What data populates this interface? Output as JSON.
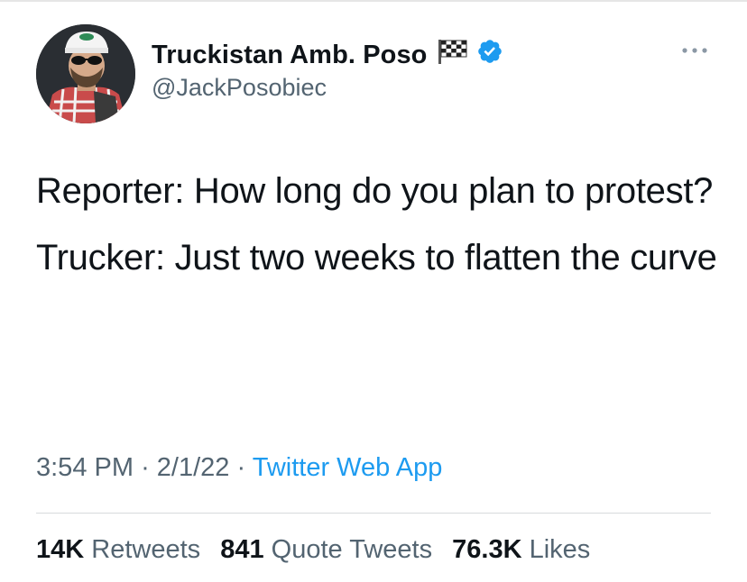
{
  "author": {
    "display_name": "Truckistan Amb. Poso",
    "handle": "@JackPosobiec"
  },
  "icons": {
    "flag": "checkered-flag-icon",
    "verified": "verified-badge-icon",
    "more": "more-options-icon"
  },
  "tweet": {
    "paragraphs": [
      "Reporter: How long do you plan to protest?",
      "Trucker: Just two weeks to flatten the curve"
    ]
  },
  "meta": {
    "time": "3:54 PM",
    "date": "2/1/22",
    "sep": "·",
    "source": "Twitter Web App"
  },
  "stats": {
    "retweets_count": "14K",
    "retweets_label": "Retweets",
    "quotes_count": "841",
    "quotes_label": "Quote Tweets",
    "likes_count": "76.3K",
    "likes_label": "Likes"
  },
  "colors": {
    "accent": "#1d9bf0",
    "secondary_text": "#536471",
    "primary_text": "#0f1419"
  }
}
